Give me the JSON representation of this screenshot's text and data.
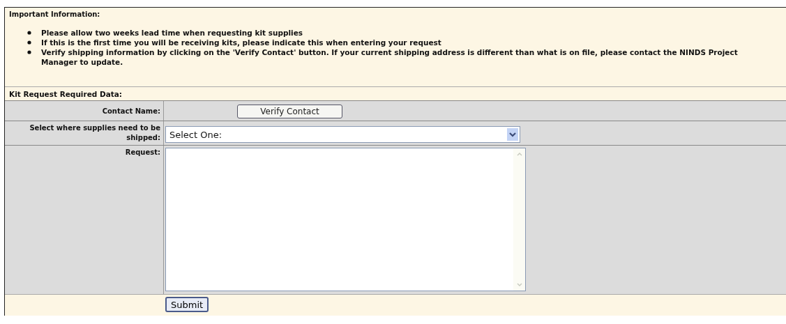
{
  "important_information": {
    "heading": "Important Information:",
    "items": [
      "Please allow two weeks lead time when requesting kit supplies",
      "If this is the first time you will be receiving kits, please indicate this when entering your request",
      "Verify shipping information by clicking on the 'Verify Contact' button. If your current shipping address is different than what is on file, please contact the NINDS Project Manager to update."
    ]
  },
  "form": {
    "heading": "Kit Request Required Data:",
    "contact_name": {
      "label": "Contact Name:",
      "button": "Verify Contact"
    },
    "ship_to": {
      "label": "Select where supplies need to be shipped:",
      "value": "Select One:"
    },
    "request": {
      "label": "Request:"
    },
    "submit": "Submit"
  }
}
